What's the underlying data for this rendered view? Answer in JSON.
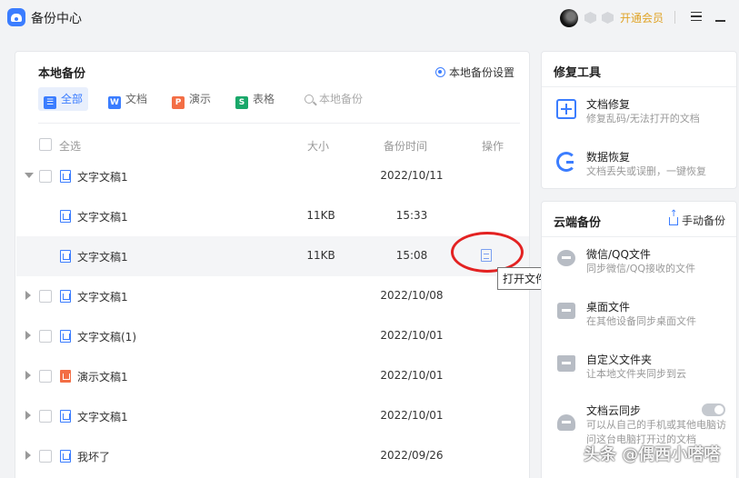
{
  "app": {
    "title": "备份中心"
  },
  "header": {
    "vip_label": "开通会员"
  },
  "local": {
    "title": "本地备份",
    "settings_label": "本地备份设置",
    "filters": [
      {
        "label": "全部",
        "icon": "list-icon",
        "color": "#3b7dff"
      },
      {
        "label": "文档",
        "icon": "word-icon",
        "color": "#3b7dff"
      },
      {
        "label": "演示",
        "icon": "ppt-icon",
        "color": "#f36e45"
      },
      {
        "label": "表格",
        "icon": "sheet-icon",
        "color": "#1aa86a"
      }
    ],
    "search_placeholder": "本地备份",
    "columns": {
      "select_all": "全选",
      "size": "大小",
      "time": "备份时间",
      "action": "操作"
    },
    "rows": [
      {
        "name": "文字文稿1",
        "size": "",
        "time": "2022/10/11",
        "type": "doc",
        "expanded": true
      },
      {
        "name": "文字文稿1",
        "size": "11KB",
        "time": "15:33",
        "type": "doc",
        "child": true
      },
      {
        "name": "文字文稿1",
        "size": "11KB",
        "time": "15:08",
        "type": "doc",
        "child": true,
        "selected": true
      },
      {
        "name": "文字文稿1",
        "size": "",
        "time": "2022/10/08",
        "type": "doc"
      },
      {
        "name": "文字文稿(1)",
        "size": "",
        "time": "2022/10/01",
        "type": "doc"
      },
      {
        "name": "演示文稿1",
        "size": "",
        "time": "2022/10/01",
        "type": "ppt"
      },
      {
        "name": "文字文稿1",
        "size": "",
        "time": "2022/10/01",
        "type": "doc"
      },
      {
        "name": "我坏了",
        "size": "",
        "time": "2022/09/26",
        "type": "doc"
      }
    ],
    "tooltip": "打开文件"
  },
  "repair": {
    "title": "修复工具",
    "tools": [
      {
        "title": "文档修复",
        "desc": "修复乱码/无法打开的文档",
        "icon": "repair-icon"
      },
      {
        "title": "数据恢复",
        "desc": "文档丢失或误删，一键恢复",
        "icon": "recover-icon"
      }
    ]
  },
  "cloud": {
    "title": "云端备份",
    "manual_label": "手动备份",
    "items": [
      {
        "title": "微信/QQ文件",
        "desc": "同步微信/QQ接收的文件",
        "icon": "wechat-qq-icon"
      },
      {
        "title": "桌面文件",
        "desc": "在其他设备同步桌面文件",
        "icon": "desktop-icon"
      },
      {
        "title": "自定义文件夹",
        "desc": "让本地文件夹同步到云",
        "icon": "folder-icon"
      },
      {
        "title": "文档云同步",
        "desc": "可以从自己的手机或其他电脑访问这台电脑打开过的文档",
        "icon": "cloud-sync-icon",
        "toggle": false
      }
    ]
  },
  "watermark": "头条 @偶西小嗒嗒"
}
